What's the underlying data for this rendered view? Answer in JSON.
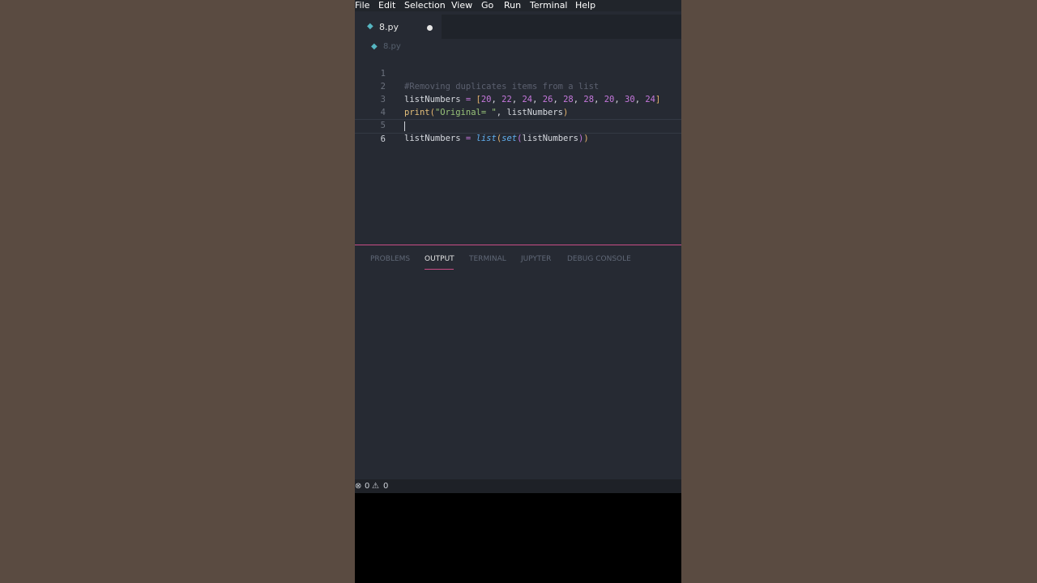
{
  "menu": {
    "items": [
      "File",
      "Edit",
      "Selection",
      "View",
      "Go",
      "Run",
      "Terminal",
      "Help"
    ]
  },
  "tab": {
    "filename": "8.py",
    "icon": "python-file-icon",
    "unsaved": true
  },
  "breadcrumb": {
    "filename": "8.py"
  },
  "editor": {
    "lines": [
      {
        "number": "1",
        "text": "#Removing duplicates items from a list"
      },
      {
        "number": "2",
        "text": "listNumbers = [20, 22, 24, 26, 28, 28, 20, 30, 24]"
      },
      {
        "number": "3",
        "text": "print(\"Original= \", listNumbers)"
      },
      {
        "number": "4",
        "text": ""
      },
      {
        "number": "5",
        "text": "listNumbers = list(set(listNumbers))"
      },
      {
        "number": "6",
        "text": ""
      }
    ],
    "active_line": "6"
  },
  "panel": {
    "tabs": [
      "PROBLEMS",
      "OUTPUT",
      "TERMINAL",
      "JUPYTER",
      "DEBUG CONSOLE"
    ],
    "active_tab": "OUTPUT"
  },
  "status": {
    "errors": "0",
    "warnings": "0"
  },
  "colors": {
    "accent": "#c94d86",
    "editor_bg": "#262a33",
    "page_bg": "#5a4b41"
  }
}
